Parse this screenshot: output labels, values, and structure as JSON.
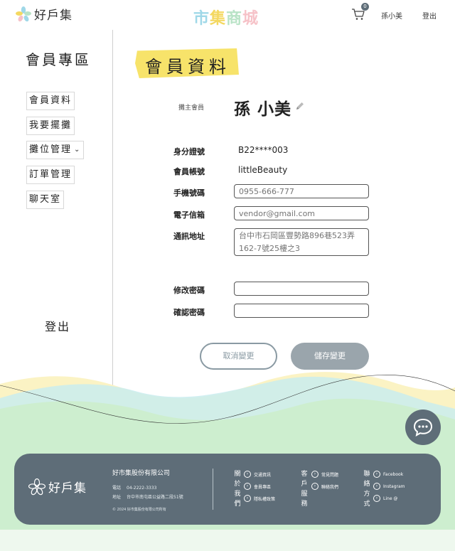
{
  "header": {
    "logo_text": "好戶集",
    "brand_chars": [
      "市",
      "集",
      "商",
      "城"
    ],
    "cart_count": "0",
    "user_name": "孫小美",
    "logout": "登出"
  },
  "sidebar": {
    "title": "會員專區",
    "items": [
      {
        "label": "會員資料"
      },
      {
        "label": "我要擺攤"
      },
      {
        "label": "攤位管理"
      },
      {
        "label": "訂單管理"
      },
      {
        "label": "聊天室"
      }
    ],
    "logout": "登出"
  },
  "main": {
    "title": "會員資料",
    "member_type": "攤主會員",
    "member_name": "孫 小美",
    "fields": {
      "id_label": "身分證號",
      "id_value": "B22****003",
      "account_label": "會員帳號",
      "account_value": "littleBeauty",
      "phone_label": "手機號碼",
      "phone_placeholder": "0955-666-777",
      "email_label": "電子信箱",
      "email_placeholder": "vendor@gmail.com",
      "address_label": "通訊地址",
      "address_placeholder": "台中市石岡區豐勢路896巷523弄162-7號25樓之3",
      "password_label": "修改密碼",
      "confirm_label": "確認密碼"
    },
    "cancel_button": "取消變更",
    "save_button": "儲存變更"
  },
  "footer": {
    "logo_text": "好戶集",
    "company": "好市集股份有限公司",
    "phone_key": "電話",
    "phone": "04-2222-3333",
    "address_key": "地址",
    "address": "台中市南屯區公益路二段51號",
    "copyright": "© 2024 好市集股份有限公司所有",
    "col1_title": "關於我們",
    "col1_links": [
      "交通資訊",
      "會員專區",
      "隱私權政策"
    ],
    "col2_title": "客戶服務",
    "col2_links": [
      "常見問題",
      "聯絡我們"
    ],
    "col3_title": "聯絡方式",
    "col3_links": [
      "Facebook",
      "Instagram",
      "Line @"
    ]
  },
  "colors": {
    "accent": "#5e6d78",
    "highlight": "#f7e36a",
    "wave_green": "#cdeecf",
    "wave_blue": "#c9ecee",
    "wave_yellow": "#fbf3c4"
  },
  "icons": [
    "flower-logo-icon",
    "cart-icon",
    "chevron-down-icon",
    "pencil-icon",
    "chat-icon",
    "arrow-right-icon"
  ]
}
